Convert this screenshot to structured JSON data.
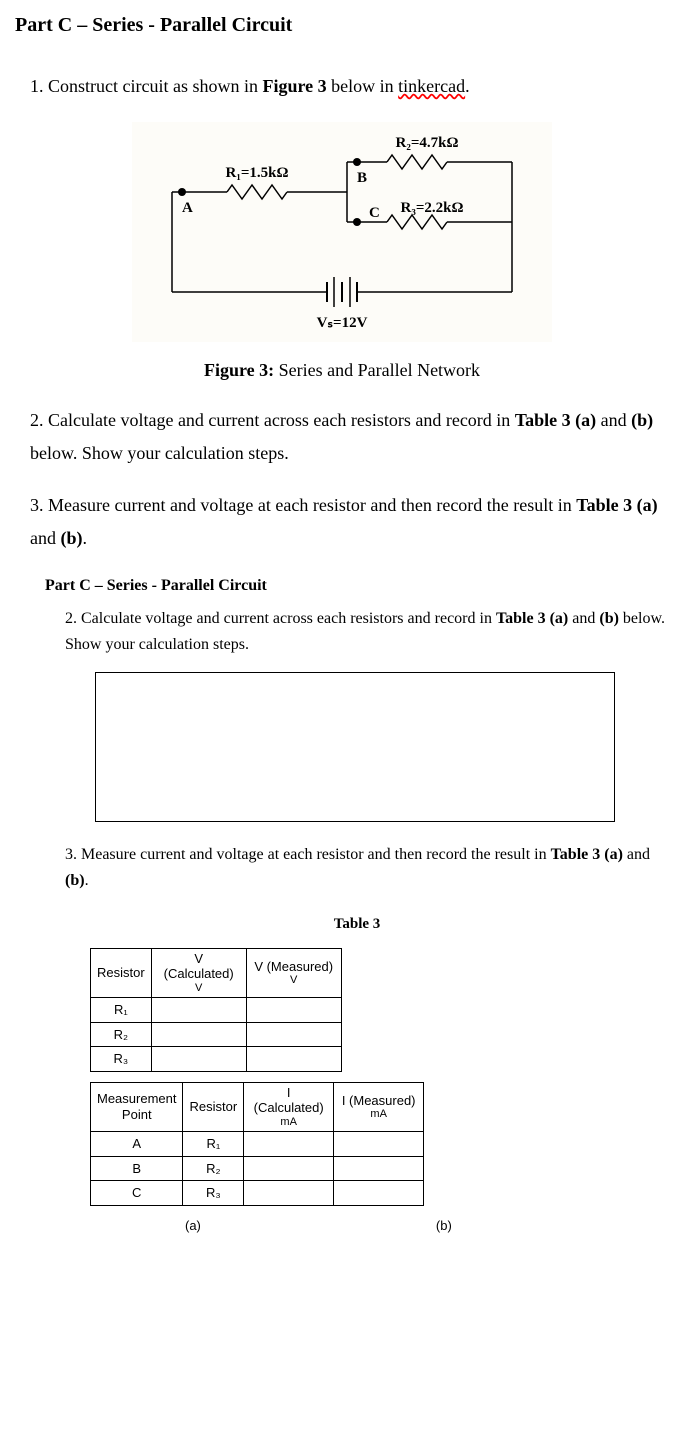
{
  "title": "Part C – Series - Parallel Circuit",
  "instruction1": {
    "num": "1.",
    "text_a": " Construct circuit as shown in ",
    "bold": "Figure 3",
    "text_b": " below in ",
    "link": "tinkercad",
    "text_c": "."
  },
  "circuit": {
    "r1": "R₁=1.5kΩ",
    "r2": "R₂=4.7kΩ",
    "r3": "R₃=2.2kΩ",
    "nodeA": "A",
    "nodeB": "B",
    "nodeC": "C",
    "vs": "Vₛ=12V"
  },
  "figure_caption": {
    "bold": "Figure 3:",
    "text": " Series and Parallel Network"
  },
  "instruction2": {
    "num": "2.",
    "text_a": " Calculate voltage and current across each resistors and record in ",
    "bold": "Table 3 (a)",
    "text_b": " and ",
    "bold2": "(b)",
    "text_c": " below. Show your calculation steps."
  },
  "instruction3": {
    "num": "3.",
    "text_a": " Measure current and voltage at each resistor and then record the result in ",
    "bold": "Table 3 (a)",
    "text_b": " and ",
    "bold2": "(b)",
    "text_c": "."
  },
  "sub": {
    "title": "Part C – Series - Parallel Circuit",
    "inst2": {
      "num": "2.",
      "text_a": " Calculate voltage and current across each resistors and record in ",
      "bold": "Table 3 (a)",
      "text_b": " and ",
      "bold2": "(b)",
      "text_c": " below. Show your calculation steps."
    },
    "inst3": {
      "num": "3.",
      "text_a": " Measure current and voltage at each resistor and then record the result in ",
      "bold": "Table 3 (a)",
      "text_b": " and ",
      "bold2": "(b)",
      "text_c": "."
    }
  },
  "table_title": "Table 3",
  "tableA": {
    "h1": "Resistor",
    "h2_top": "V (Calculated)",
    "h2_bot": "V",
    "h3_top": "V (Measured)",
    "h3_bot": "V",
    "rows": [
      "R₁",
      "R₂",
      "R₃"
    ]
  },
  "tableB": {
    "h1_top": "Measurement",
    "h1_bot": "Point",
    "h2": "Resistor",
    "h3_top": "I (Calculated)",
    "h3_bot": "mA",
    "h4_top": "I (Measured)",
    "h4_bot": "mA",
    "rows": [
      {
        "point": "A",
        "res": "R₁"
      },
      {
        "point": "B",
        "res": "R₂"
      },
      {
        "point": "C",
        "res": "R₃"
      }
    ]
  },
  "labels": {
    "a": "(a)",
    "b": "(b)"
  }
}
